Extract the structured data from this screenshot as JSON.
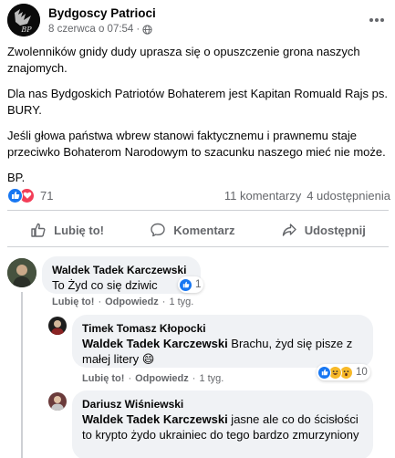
{
  "post": {
    "page_name": "Bydgoscy Patrioci",
    "date": "8 czerwca o 07:54",
    "meta_separator": "·",
    "paragraphs": [
      "Zwolenników gnidy dudy uprasza się o opuszczenie grona naszych znajomych.",
      "Dla nas Bydgoskich Patriotów Bohaterem jest Kapitan Romuald Rajs ps. BURY.",
      "Jeśli głowa państwa wbrew stanowi faktycznemu i prawnemu staje przeciwko Bohaterom Narodowym to szacunku naszego mieć nie może.",
      "BP."
    ],
    "avatar_text": "BP"
  },
  "stats": {
    "reaction_count": "71",
    "comments": "11 komentarzy",
    "shares": "4 udostępnienia"
  },
  "actions": {
    "like": "Lubię to!",
    "comment": "Komentarz",
    "share": "Udostępnij"
  },
  "comments": [
    {
      "author": "Waldek Tadek Karczewski",
      "text": "To Żyd co się dziwic",
      "reaction_count": "1",
      "like": "Lubię to!",
      "reply": "Odpowiedz",
      "time": "1 tyg.",
      "sep": "·"
    }
  ],
  "replies": [
    {
      "author": "Timek Tomasz Kłopocki",
      "mention": "Waldek Tadek Karczewski",
      "text": " Brachu, żyd się pisze z małej litery 😄",
      "reaction_count": "10",
      "like": "Lubię to!",
      "reply": "Odpowiedz",
      "time": "1 tyg.",
      "sep": "·"
    },
    {
      "author": "Dariusz Wiśniewski",
      "mention": "Waldek Tadek Karczewski",
      "text": " jasne ale co do ścisłości to krypto żydo ukrainiec do tego bardzo zmurzyniony"
    }
  ],
  "colors": {
    "facebook_blue": "#1877f2",
    "love_red": "#f33e58",
    "haha_yellow": "#f7b928",
    "secondary_text": "#65676b",
    "bubble_bg": "#f0f2f5"
  }
}
